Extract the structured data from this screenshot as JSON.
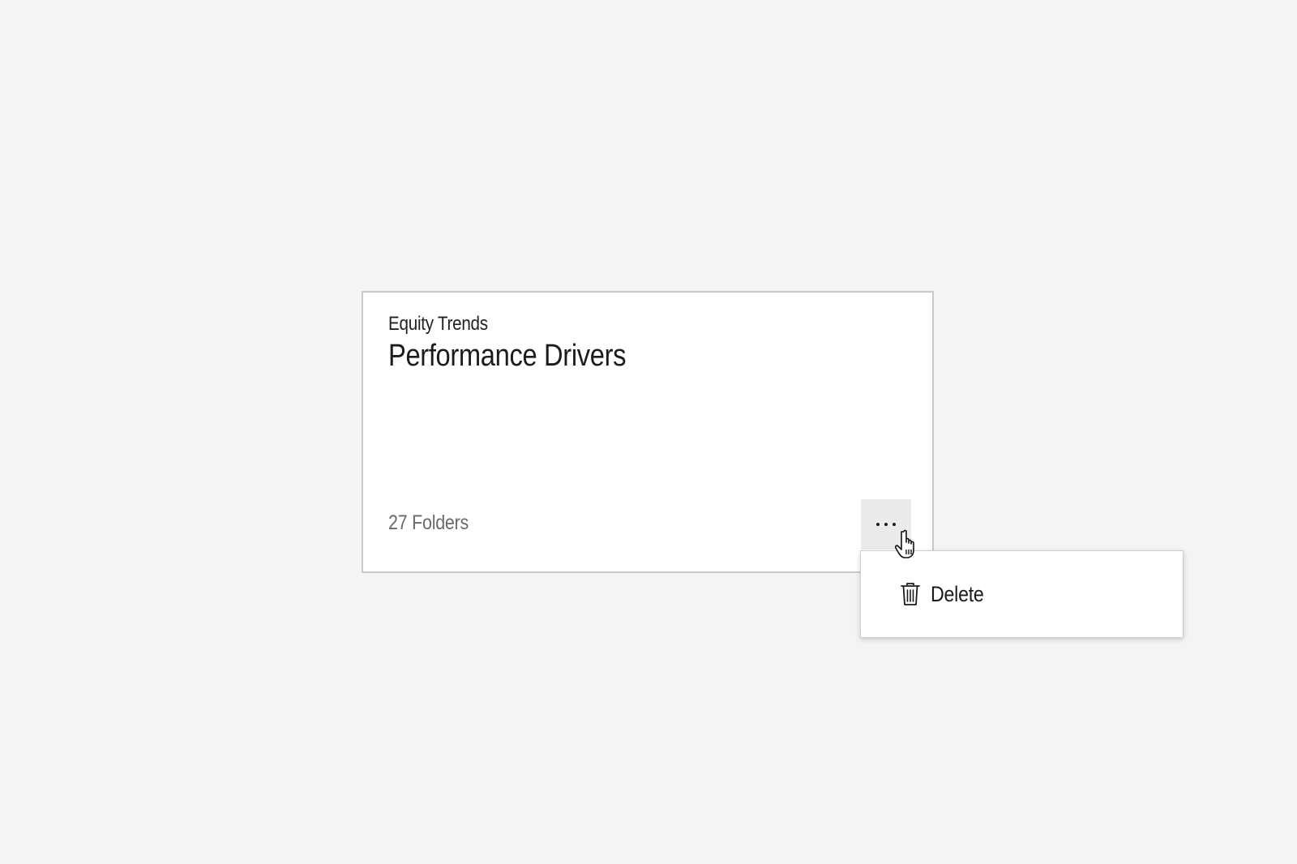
{
  "card": {
    "subtitle": "Equity Trends",
    "title": "Performance Drivers",
    "count_label": "27 Folders",
    "more_button_icon": "more-horizontal-icon",
    "more_button_background": "#ebebea"
  },
  "menu": {
    "items": [
      {
        "label": "Delete",
        "icon": "trash-icon"
      }
    ]
  },
  "cursor": {
    "icon": "hand-pointer-icon"
  },
  "colors": {
    "page_background": "#f5f4f2",
    "card_border": "#c9c9c9",
    "text_primary": "#1c1c1c",
    "text_secondary": "#6a6a6a"
  }
}
